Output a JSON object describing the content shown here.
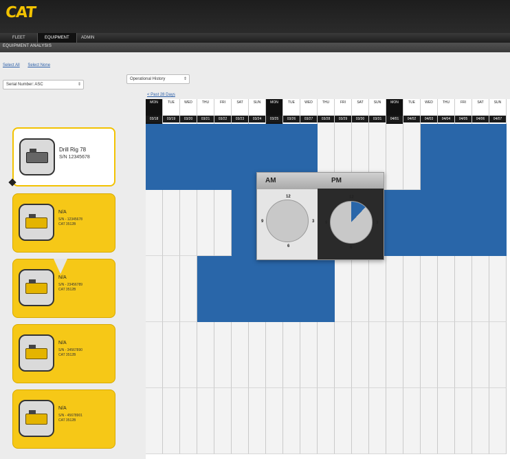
{
  "brand": {
    "logo_text": "CAT",
    "accent": "#f2c200"
  },
  "tabs": [
    {
      "label": "Fleet",
      "active": false
    },
    {
      "label": "Equipment",
      "active": true
    },
    {
      "label": "Admin",
      "active": false
    }
  ],
  "section_title": "Equipment Analysis",
  "left": {
    "links": [
      "Select All",
      "Select None"
    ],
    "sort_select": "Serial Number: ASC"
  },
  "history_select": "Operational History",
  "back_link": "< Past 28 Days",
  "equipment": [
    {
      "name": "Drill Rig 78",
      "sub": "S/N 12345678",
      "selected": true
    },
    {
      "name": "N/A",
      "sub": "S/N - 12345678\nCAT 3512B",
      "selected": false
    },
    {
      "name": "N/A",
      "sub": "S/N - 23456789\nCAT 3512B",
      "selected": false
    },
    {
      "name": "N/A",
      "sub": "S/N - 34567890\nCAT 3512B",
      "selected": false
    },
    {
      "name": "N/A",
      "sub": "S/N - 45678901\nCAT 3512B",
      "selected": false
    }
  ],
  "days": [
    {
      "dow": "MON",
      "date": "03/18",
      "dark": true
    },
    {
      "dow": "TUE",
      "date": "03/19",
      "dark": false
    },
    {
      "dow": "WED",
      "date": "03/20",
      "dark": false
    },
    {
      "dow": "THU",
      "date": "03/21",
      "dark": false
    },
    {
      "dow": "FRI",
      "date": "03/22",
      "dark": false
    },
    {
      "dow": "SAT",
      "date": "03/23",
      "dark": false
    },
    {
      "dow": "SUN",
      "date": "03/24",
      "dark": false
    },
    {
      "dow": "MON",
      "date": "03/25",
      "dark": true
    },
    {
      "dow": "TUE",
      "date": "03/26",
      "dark": false
    },
    {
      "dow": "WED",
      "date": "03/27",
      "dark": false
    },
    {
      "dow": "THU",
      "date": "03/28",
      "dark": false
    },
    {
      "dow": "FRI",
      "date": "03/29",
      "dark": false
    },
    {
      "dow": "SAT",
      "date": "03/30",
      "dark": false
    },
    {
      "dow": "SUN",
      "date": "03/31",
      "dark": false
    },
    {
      "dow": "MON",
      "date": "04/01",
      "dark": true
    },
    {
      "dow": "TUE",
      "date": "04/02",
      "dark": false
    },
    {
      "dow": "WED",
      "date": "04/03",
      "dark": false
    },
    {
      "dow": "THU",
      "date": "04/04",
      "dark": false
    },
    {
      "dow": "FRI",
      "date": "04/05",
      "dark": false
    },
    {
      "dow": "SAT",
      "date": "04/06",
      "dark": false
    },
    {
      "dow": "SUN",
      "date": "04/07",
      "dark": false
    }
  ],
  "activity_rows": [
    [
      1,
      1,
      1,
      1,
      1,
      1,
      1,
      1,
      1,
      1,
      0,
      0,
      0,
      0,
      0,
      0,
      1,
      1,
      1,
      1,
      1
    ],
    [
      0,
      0,
      0,
      0,
      0,
      1,
      1,
      1,
      1,
      1,
      1,
      1,
      1,
      1,
      1,
      1,
      1,
      1,
      1,
      1,
      1
    ],
    [
      0,
      0,
      0,
      1,
      1,
      1,
      1,
      1,
      1,
      1,
      1,
      0,
      0,
      0,
      0,
      0,
      0,
      0,
      0,
      0,
      0
    ],
    [
      0,
      0,
      0,
      0,
      0,
      0,
      0,
      0,
      0,
      0,
      0,
      0,
      0,
      0,
      0,
      0,
      0,
      0,
      0,
      0,
      0
    ],
    [
      0,
      0,
      0,
      0,
      0,
      0,
      0,
      0,
      0,
      0,
      0,
      0,
      0,
      0,
      0,
      0,
      0,
      0,
      0,
      0,
      0
    ]
  ],
  "popup": {
    "am_label": "AM",
    "pm_label": "PM",
    "hours": {
      "top": "12",
      "right": "3",
      "bottom": "6",
      "left": "9"
    },
    "pm_active_fraction": 0.12,
    "active_color": "#2966a9"
  }
}
